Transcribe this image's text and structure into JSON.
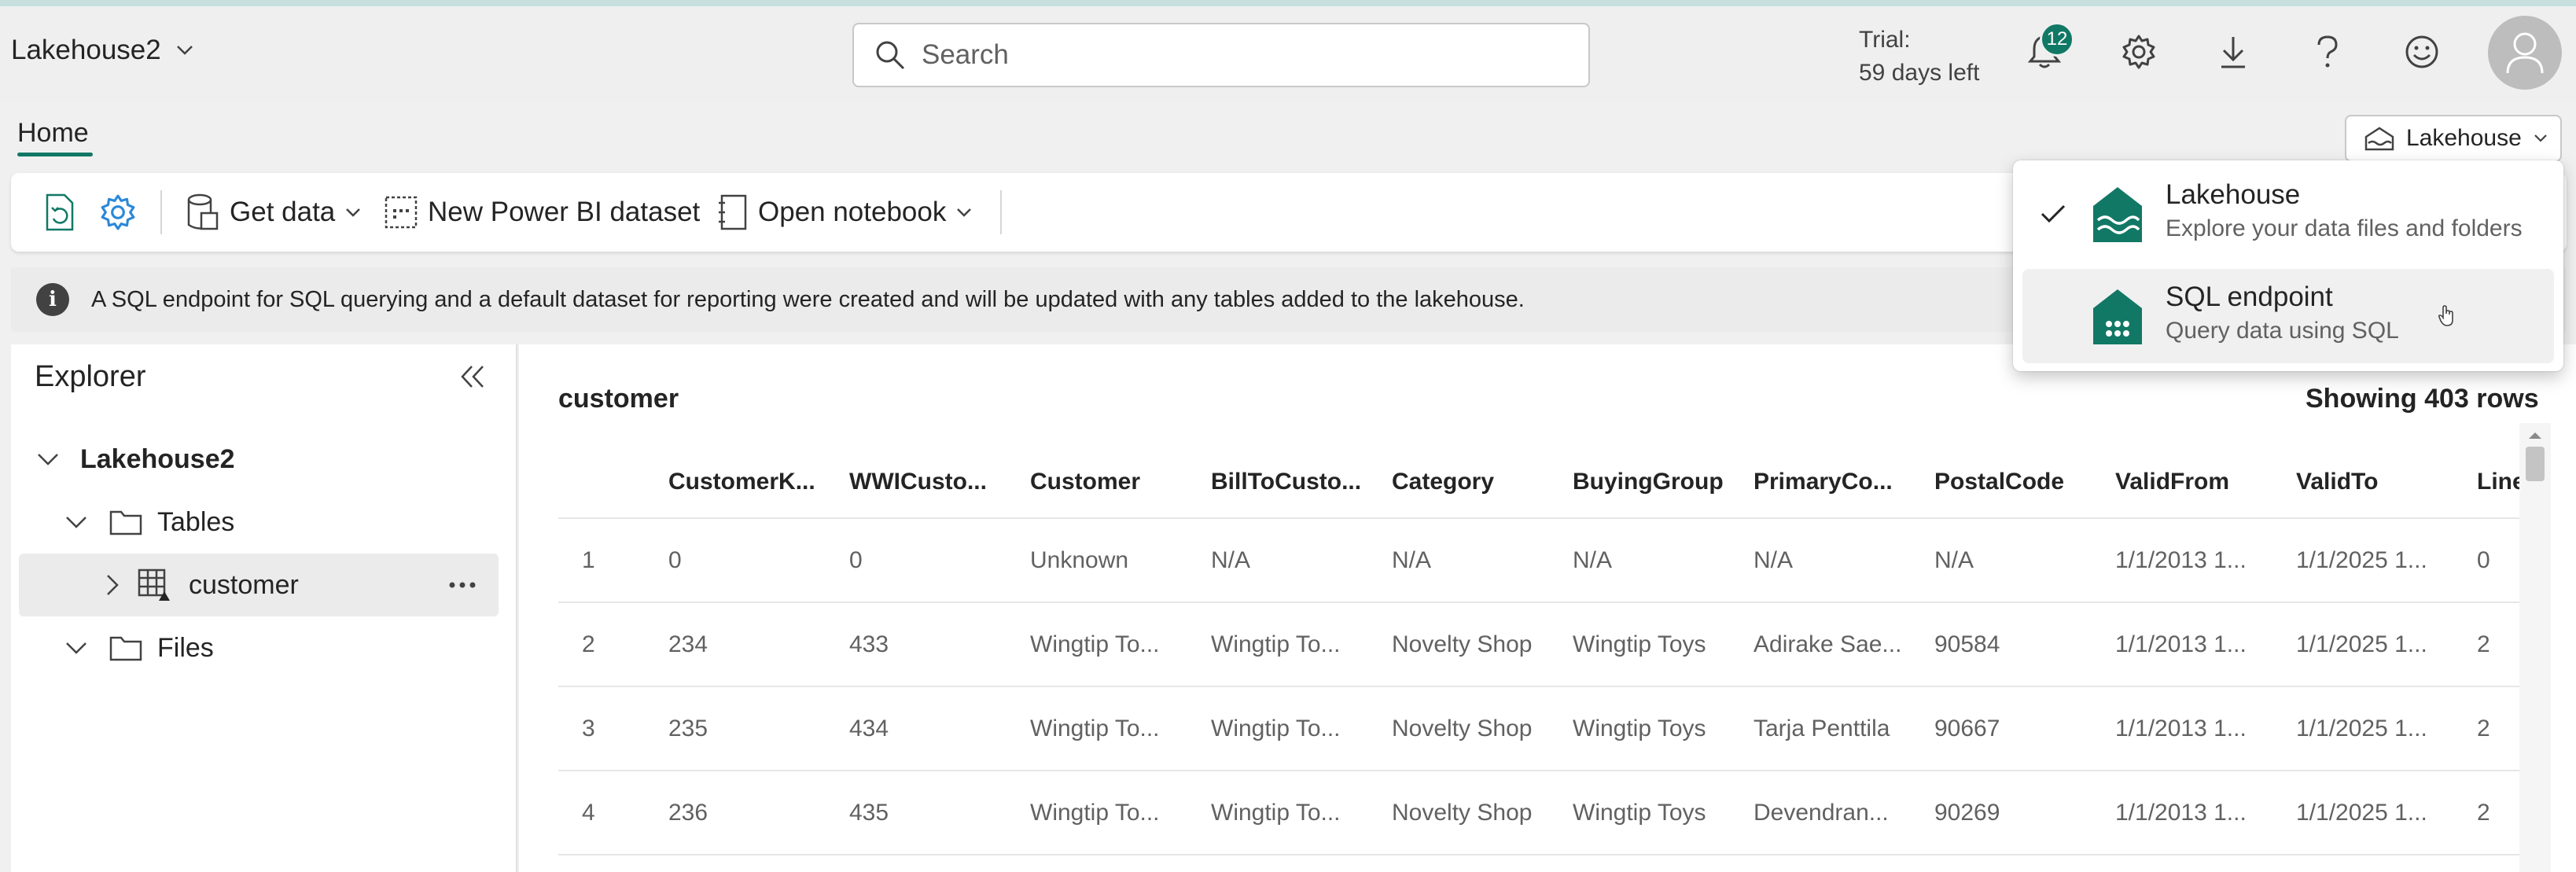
{
  "header": {
    "workspace_title": "Lakehouse2",
    "search_placeholder": "Search",
    "trial_line1": "Trial:",
    "trial_line2": "59 days left",
    "notification_count": "12",
    "icons": [
      "bell-icon",
      "gear-icon",
      "download-icon",
      "help-icon",
      "smiley-icon",
      "avatar-icon"
    ]
  },
  "ribbon": {
    "tab_home": "Home",
    "switcher_label": "Lakehouse",
    "get_data": "Get data",
    "new_dataset": "New Power BI dataset",
    "open_notebook": "Open notebook"
  },
  "info_bar": {
    "message": "A SQL endpoint for SQL querying and a default dataset for reporting were created and will be updated with any tables added to the lakehouse."
  },
  "explorer": {
    "title": "Explorer",
    "root": "Lakehouse2",
    "tables_folder": "Tables",
    "table_item": "customer",
    "files_folder": "Files"
  },
  "grid": {
    "table_name": "customer",
    "row_count_text": "Showing 403 rows",
    "columns": [
      "",
      "CustomerK...",
      "WWICusto...",
      "Customer",
      "BillToCusto...",
      "Category",
      "BuyingGroup",
      "PrimaryCo...",
      "PostalCode",
      "ValidFrom",
      "ValidTo",
      "Line"
    ],
    "rows": [
      [
        "1",
        "0",
        "0",
        "Unknown",
        "N/A",
        "N/A",
        "N/A",
        "N/A",
        "N/A",
        "1/1/2013 1...",
        "1/1/2025 1...",
        "0"
      ],
      [
        "2",
        "234",
        "433",
        "Wingtip To...",
        "Wingtip To...",
        "Novelty Shop",
        "Wingtip Toys",
        "Adirake Sae...",
        "90584",
        "1/1/2013 1...",
        "1/1/2025 1...",
        "2"
      ],
      [
        "3",
        "235",
        "434",
        "Wingtip To...",
        "Wingtip To...",
        "Novelty Shop",
        "Wingtip Toys",
        "Tarja Penttila",
        "90667",
        "1/1/2013 1...",
        "1/1/2025 1...",
        "2"
      ],
      [
        "4",
        "236",
        "435",
        "Wingtip To...",
        "Wingtip To...",
        "Novelty Shop",
        "Wingtip Toys",
        "Devendran...",
        "90269",
        "1/1/2013 1...",
        "1/1/2025 1...",
        "2"
      ]
    ]
  },
  "dropdown": {
    "items": [
      {
        "title": "Lakehouse",
        "subtitle": "Explore your data files and folders",
        "checked": true
      },
      {
        "title": "SQL endpoint",
        "subtitle": "Query data using SQL",
        "checked": false
      }
    ]
  },
  "colors": {
    "accent": "#117865",
    "badge": "#117865"
  }
}
